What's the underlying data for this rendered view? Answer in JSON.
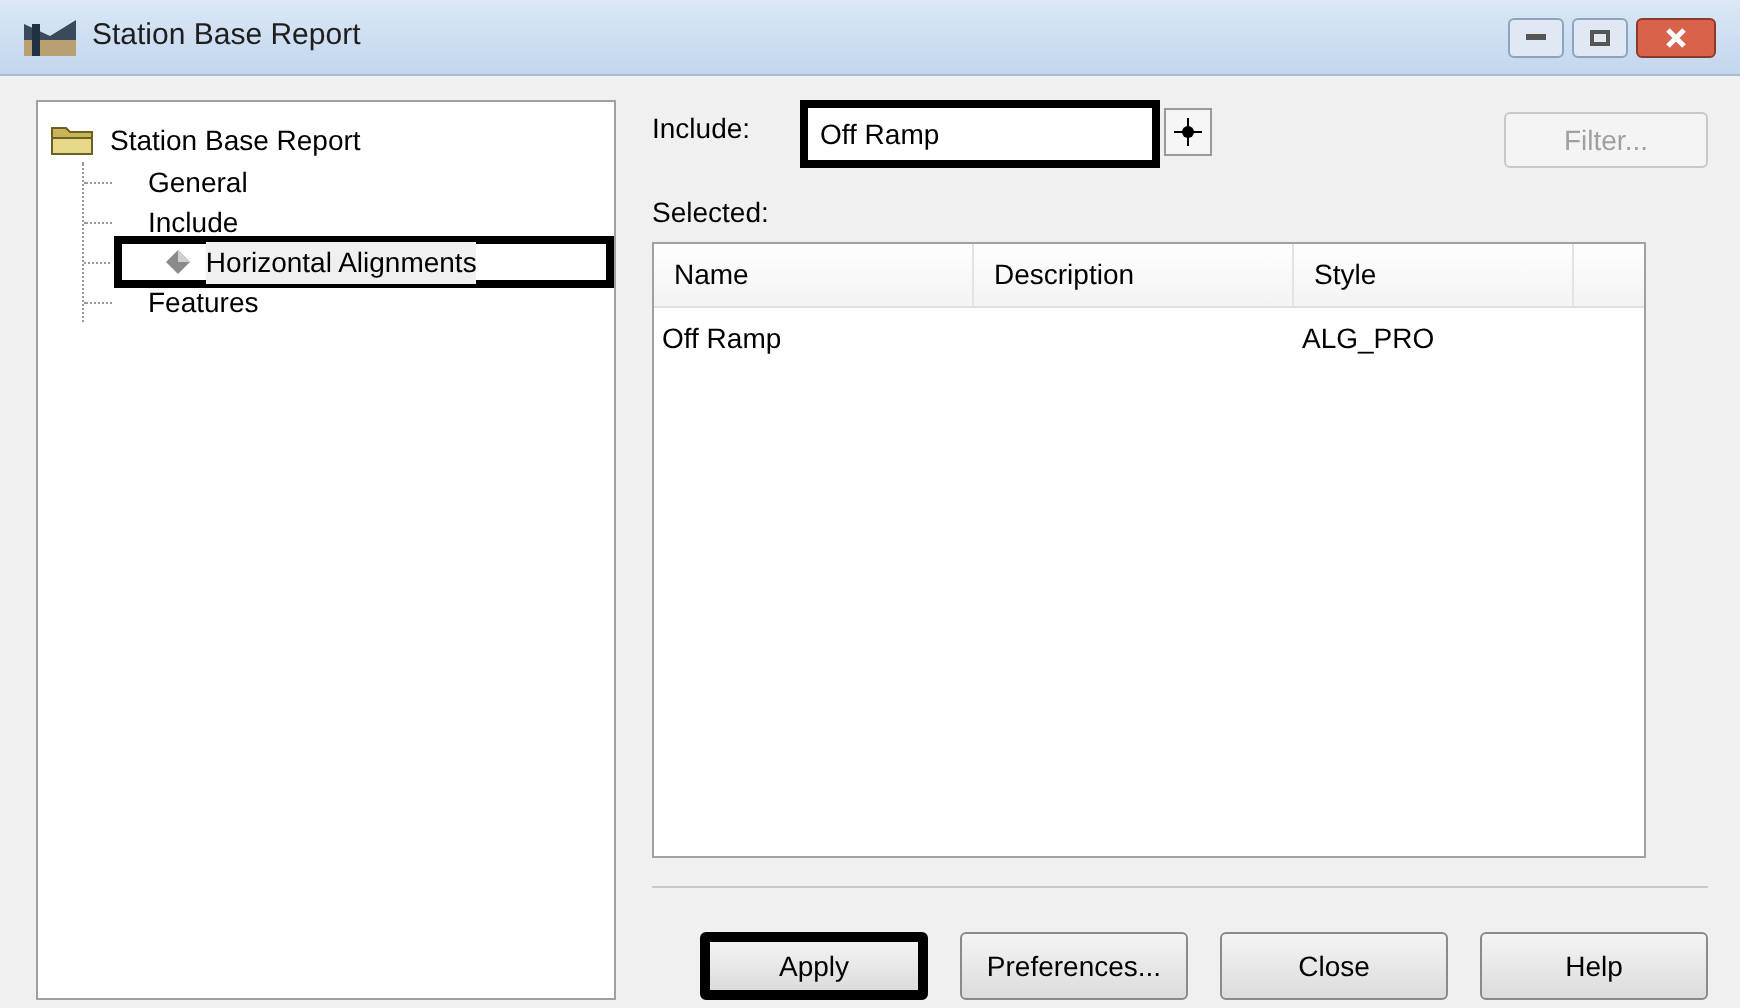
{
  "window": {
    "title": "Station Base Report"
  },
  "tree": {
    "label": "Station Base Report",
    "children": [
      {
        "label": "General",
        "selected": false,
        "highlighted": false
      },
      {
        "label": "Include",
        "selected": false,
        "highlighted": false
      },
      {
        "label": "Horizontal Alignments",
        "selected": true,
        "highlighted": true
      },
      {
        "label": "Features",
        "selected": false,
        "highlighted": false
      }
    ]
  },
  "include": {
    "label": "Include:",
    "value": "Off Ramp",
    "highlighted": true
  },
  "filter_button": {
    "label": "Filter...",
    "disabled": true
  },
  "selected_label": "Selected:",
  "table": {
    "columns": [
      "Name",
      "Description",
      "Style"
    ],
    "rows": [
      [
        "Off Ramp",
        "",
        "ALG_PRO"
      ]
    ]
  },
  "buttons": [
    {
      "label": "Apply",
      "highlighted": true
    },
    {
      "label": "Preferences...",
      "highlighted": false
    },
    {
      "label": "Close",
      "highlighted": false
    },
    {
      "label": "Help",
      "highlighted": false
    }
  ]
}
